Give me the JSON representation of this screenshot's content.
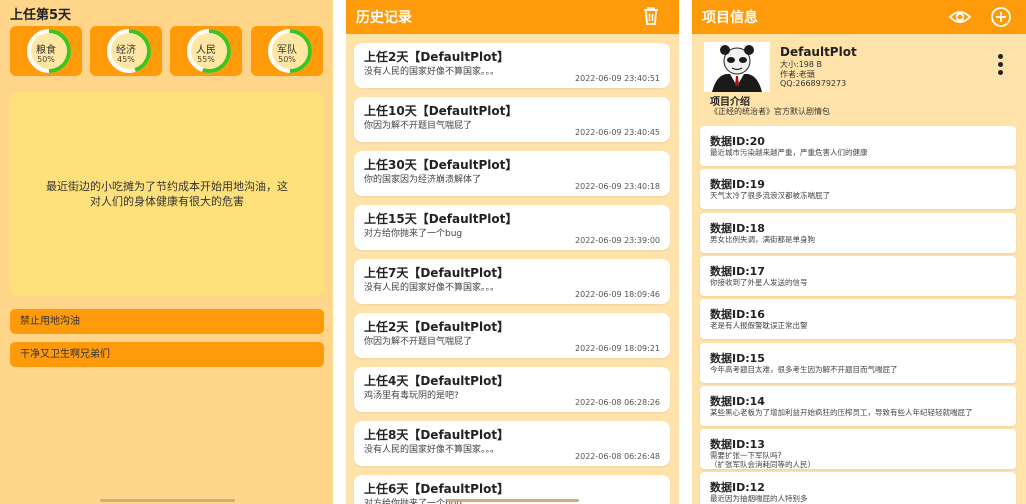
{
  "colors": {
    "accent": "#ff9a0a",
    "panel_bg": "#ffd58a",
    "card_bg": "#ffffff",
    "progress_green": "#3fc41f"
  },
  "game": {
    "title": "上任第5天",
    "stats": [
      {
        "label": "粮食",
        "value_text": "50%",
        "value": 50
      },
      {
        "label": "经济",
        "value_text": "45%",
        "value": 45
      },
      {
        "label": "人民",
        "value_text": "55%",
        "value": 55
      },
      {
        "label": "军队",
        "value_text": "50%",
        "value": 50
      }
    ],
    "event_text": "最近街边的小吃摊为了节约成本开始用地沟油，这对人们的身体健康有很大的危害",
    "choices": [
      "禁止用地沟油",
      "干净又卫生啊兄弟们"
    ]
  },
  "history": {
    "title": "历史记录",
    "icon": "trash-icon",
    "items": [
      {
        "heading": "上任2天【DefaultPlot】",
        "desc": "没有人民的国家好像不算国家。。。",
        "time": "2022-06-09 23:40:51"
      },
      {
        "heading": "上任10天【DefaultPlot】",
        "desc": "你因为解不开题目气喘屁了",
        "time": "2022-06-09 23:40:45"
      },
      {
        "heading": "上任30天【DefaultPlot】",
        "desc": "你的国家因为经济崩溃解体了",
        "time": "2022-06-09 23:40:18"
      },
      {
        "heading": "上任15天【DefaultPlot】",
        "desc": "对方给你抛来了一个bug",
        "time": "2022-06-09 23:39:00"
      },
      {
        "heading": "上任7天【DefaultPlot】",
        "desc": "没有人民的国家好像不算国家。。。",
        "time": "2022-06-09 18:09:46"
      },
      {
        "heading": "上任2天【DefaultPlot】",
        "desc": "你因为解不开题目气喘屁了",
        "time": "2022-06-09 18:09:21"
      },
      {
        "heading": "上任4天【DefaultPlot】",
        "desc": "鸡汤里有毒玩阴的是吧?",
        "time": "2022-06-08 06:28:26"
      },
      {
        "heading": "上任8天【DefaultPlot】",
        "desc": "没有人民的国家好像不算国家。。。",
        "time": "2022-06-08 06:26:48"
      },
      {
        "heading": "上任6天【DefaultPlot】",
        "desc": "对方给你抛来了一个bug",
        "time": ""
      }
    ]
  },
  "project": {
    "title": "项目信息",
    "icons": [
      "eye-icon",
      "add-circle-icon"
    ],
    "name": "DefaultPlot",
    "size": "大小:198 B",
    "author": "作者:老頭",
    "qq": "QQ:2668979273",
    "intro_title": "项目介绍",
    "intro_text": "《正经的统治者》官方默认剧情包",
    "items": [
      {
        "heading": "数据ID:20",
        "desc": "最近城市污染越来越严重，严重危害人们的健康"
      },
      {
        "heading": "数据ID:19",
        "desc": "天气太冷了很多流浪汉都被冻喘屁了"
      },
      {
        "heading": "数据ID:18",
        "desc": "男女比例失调，满街都是单身狗"
      },
      {
        "heading": "数据ID:17",
        "desc": "你接收到了外星人发送的信号"
      },
      {
        "heading": "数据ID:16",
        "desc": "老是有人报假警耽误正常出警"
      },
      {
        "heading": "数据ID:15",
        "desc": "今年高考题目太难，很多考生因为解不开题目而气喘屁了"
      },
      {
        "heading": "数据ID:14",
        "desc": "某些黑心老板为了增加利益开始疯狂的压榨员工，导致有些人年纪轻轻就喘屁了"
      },
      {
        "heading": "数据ID:13",
        "desc": "需要扩张一下军队吗?\n（扩张军队会消耗同等的人民）"
      },
      {
        "heading": "数据ID:12",
        "desc": "最近因为抽烟喘屁的人特别多"
      }
    ]
  }
}
